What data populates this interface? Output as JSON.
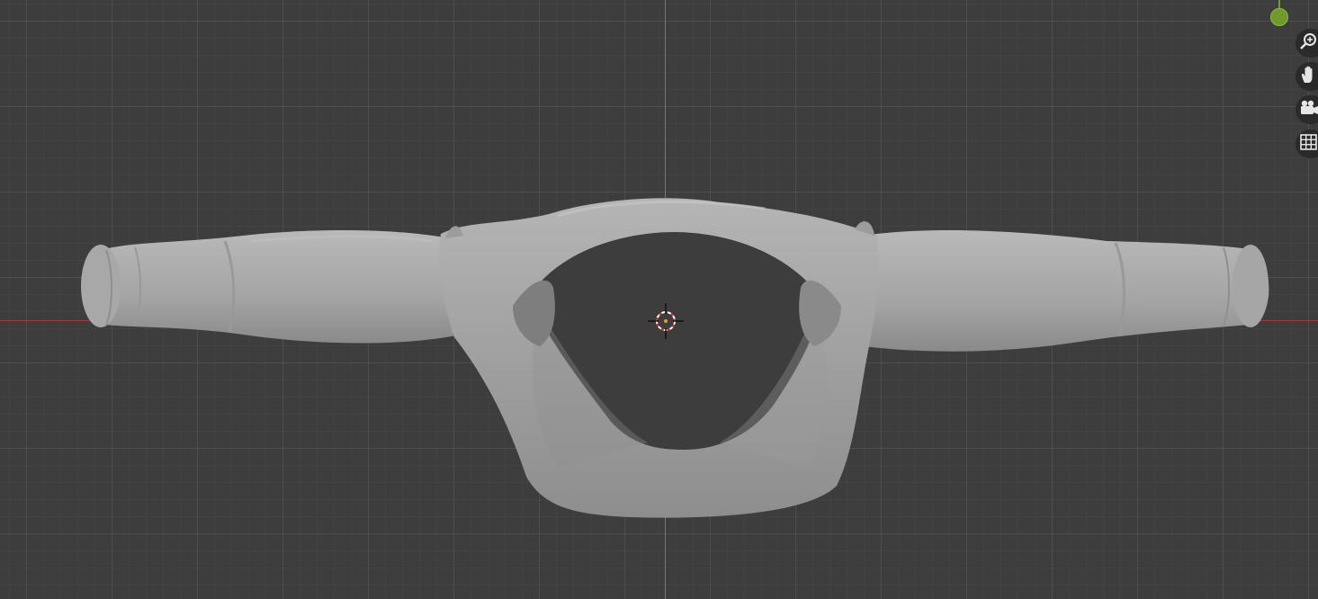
{
  "viewport": {
    "background_color": "#3d3d3d",
    "x_axis_color": "#9e3a3f",
    "y_axis_color": "#6b8e23",
    "model_color": "#a9a9a9"
  },
  "navigation": {
    "buttons": [
      {
        "icon": "zoom-icon"
      },
      {
        "icon": "hand-pan-icon"
      },
      {
        "icon": "camera-icon"
      },
      {
        "icon": "grid-ortho-icon"
      }
    ]
  },
  "gizmo": {
    "axis_color": "#6f9a2e"
  }
}
